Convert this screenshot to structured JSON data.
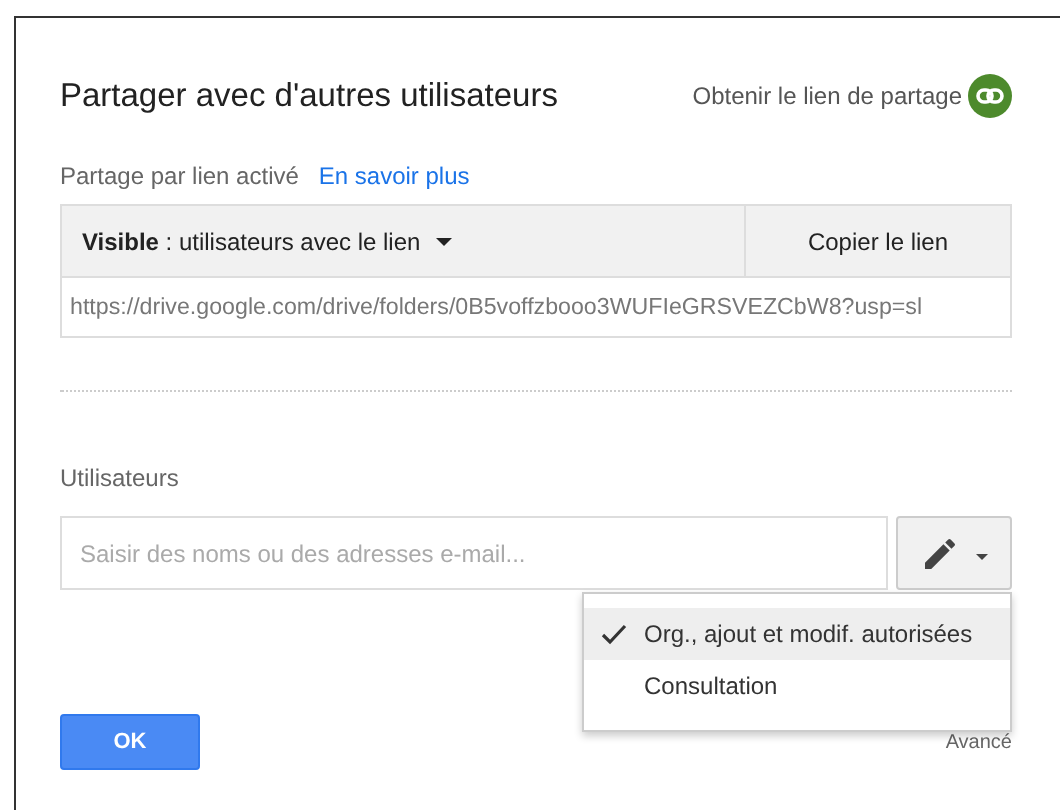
{
  "dialog": {
    "title": "Partager avec d'autres utilisateurs",
    "get_link": "Obtenir le lien de partage"
  },
  "link_sharing": {
    "status": "Partage par lien activé",
    "learn_more": "En savoir plus",
    "visibility": "**Visible** : utilisateurs avec le lien",
    "copy_button": "Copier le lien",
    "url": "https://drive.google.com/drive/folders/0B5voffzbooo3WUFIeGRSVEZCbW8?usp=sl"
  },
  "users": {
    "label": "Utilisateurs",
    "placeholder": "Saisir des noms ou des adresses e-mail..."
  },
  "permission_menu": [
    {
      "label": "Org., ajout et modif. autorisées",
      "selected": true
    },
    {
      "label": "Consultation",
      "selected": false
    }
  ],
  "buttons": {
    "ok": "OK",
    "advanced": "Avancé"
  }
}
